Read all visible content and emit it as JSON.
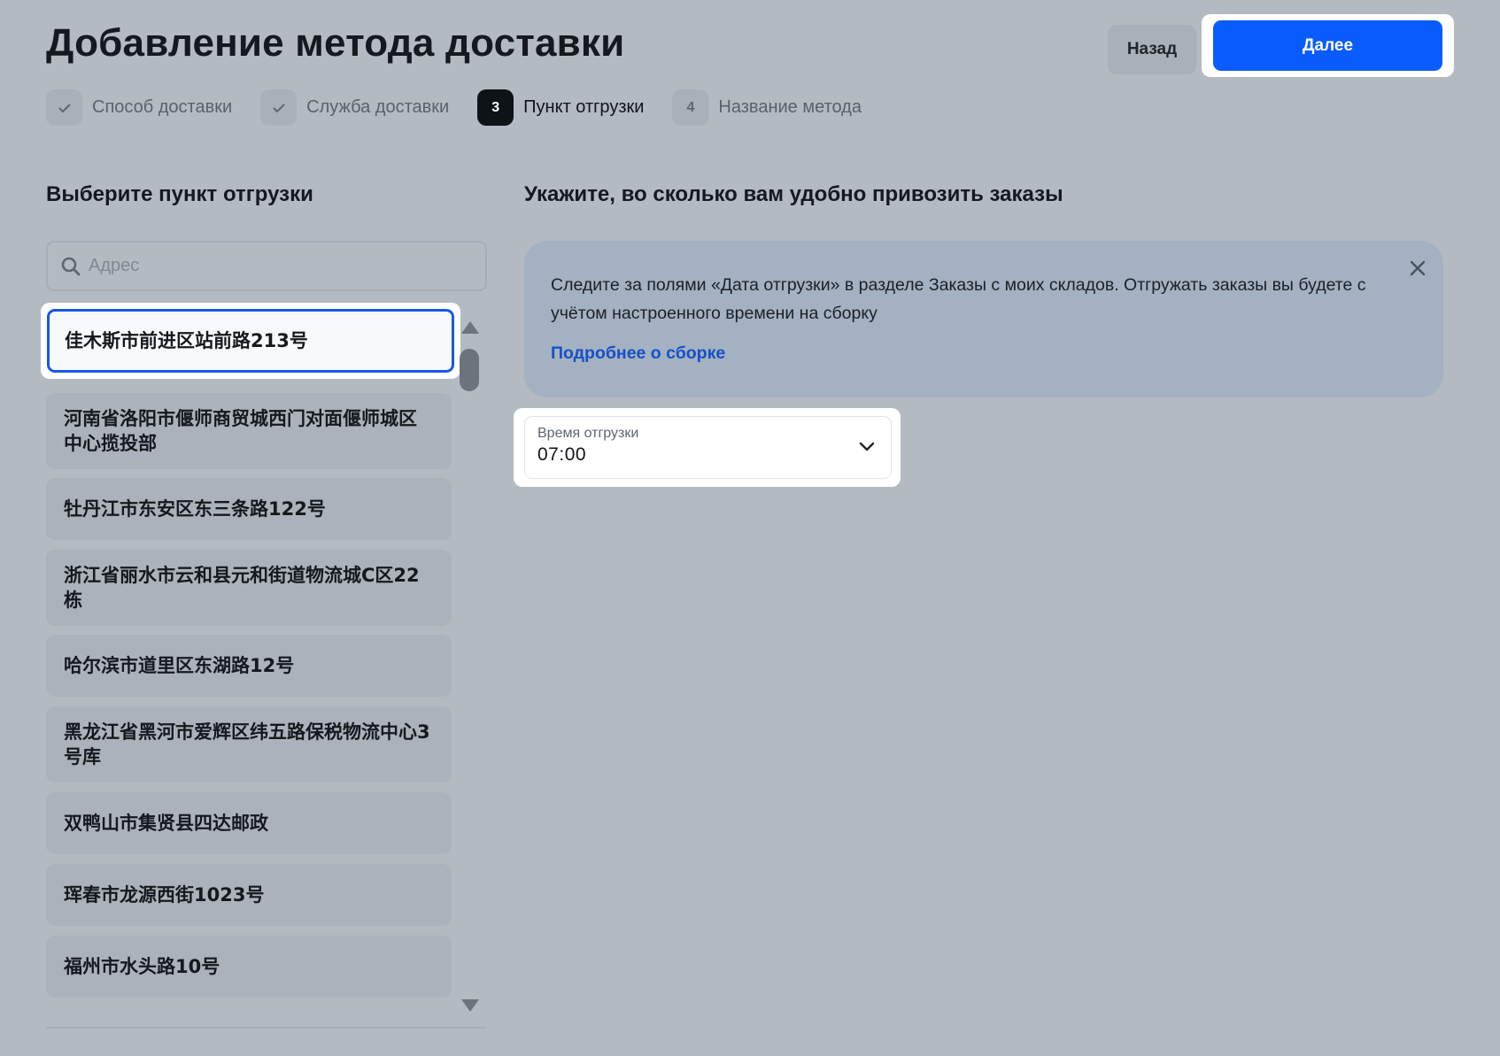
{
  "header": {
    "title": "Добавление метода доставки",
    "back_label": "Назад",
    "next_label": "Далее"
  },
  "stepper": [
    {
      "num": "",
      "label": "Способ доставки",
      "state": "done"
    },
    {
      "num": "",
      "label": "Служба доставки",
      "state": "done"
    },
    {
      "num": "3",
      "label": "Пункт отгрузки",
      "state": "active"
    },
    {
      "num": "4",
      "label": "Название метода",
      "state": "pending"
    }
  ],
  "left": {
    "title": "Выберите пункт отгрузки",
    "search_placeholder": "Адрес",
    "items": [
      "佳木斯市前进区站前路213号",
      "河南省洛阳市偃师商贸城西门对面偃师城区中心揽投部",
      "牡丹江市东安区东三条路122号",
      "浙江省丽水市云和县元和街道物流城C区22栋",
      "哈尔滨市道里区东湖路12号",
      "黑龙江省黑河市爱辉区纬五路保税物流中心3号库",
      "双鸭山市集贤县四达邮政",
      "珲春市龙源西街1023号",
      "福州市水头路10号"
    ],
    "selected_index": 0
  },
  "right": {
    "title": "Укажите, во сколько вам удобно привозить заказы",
    "info_text": "Следите за полями «Дата отгрузки» в разделе Заказы с моих складов. Отгружать заказы вы будете с учётом настроенного времени на сборку",
    "info_link": "Подробнее о сборке",
    "time_label": "Время отгрузки",
    "time_value": "07:00"
  },
  "colors": {
    "accent": "#0a5cff",
    "link": "#1750c9",
    "background": "#b4bac2"
  }
}
